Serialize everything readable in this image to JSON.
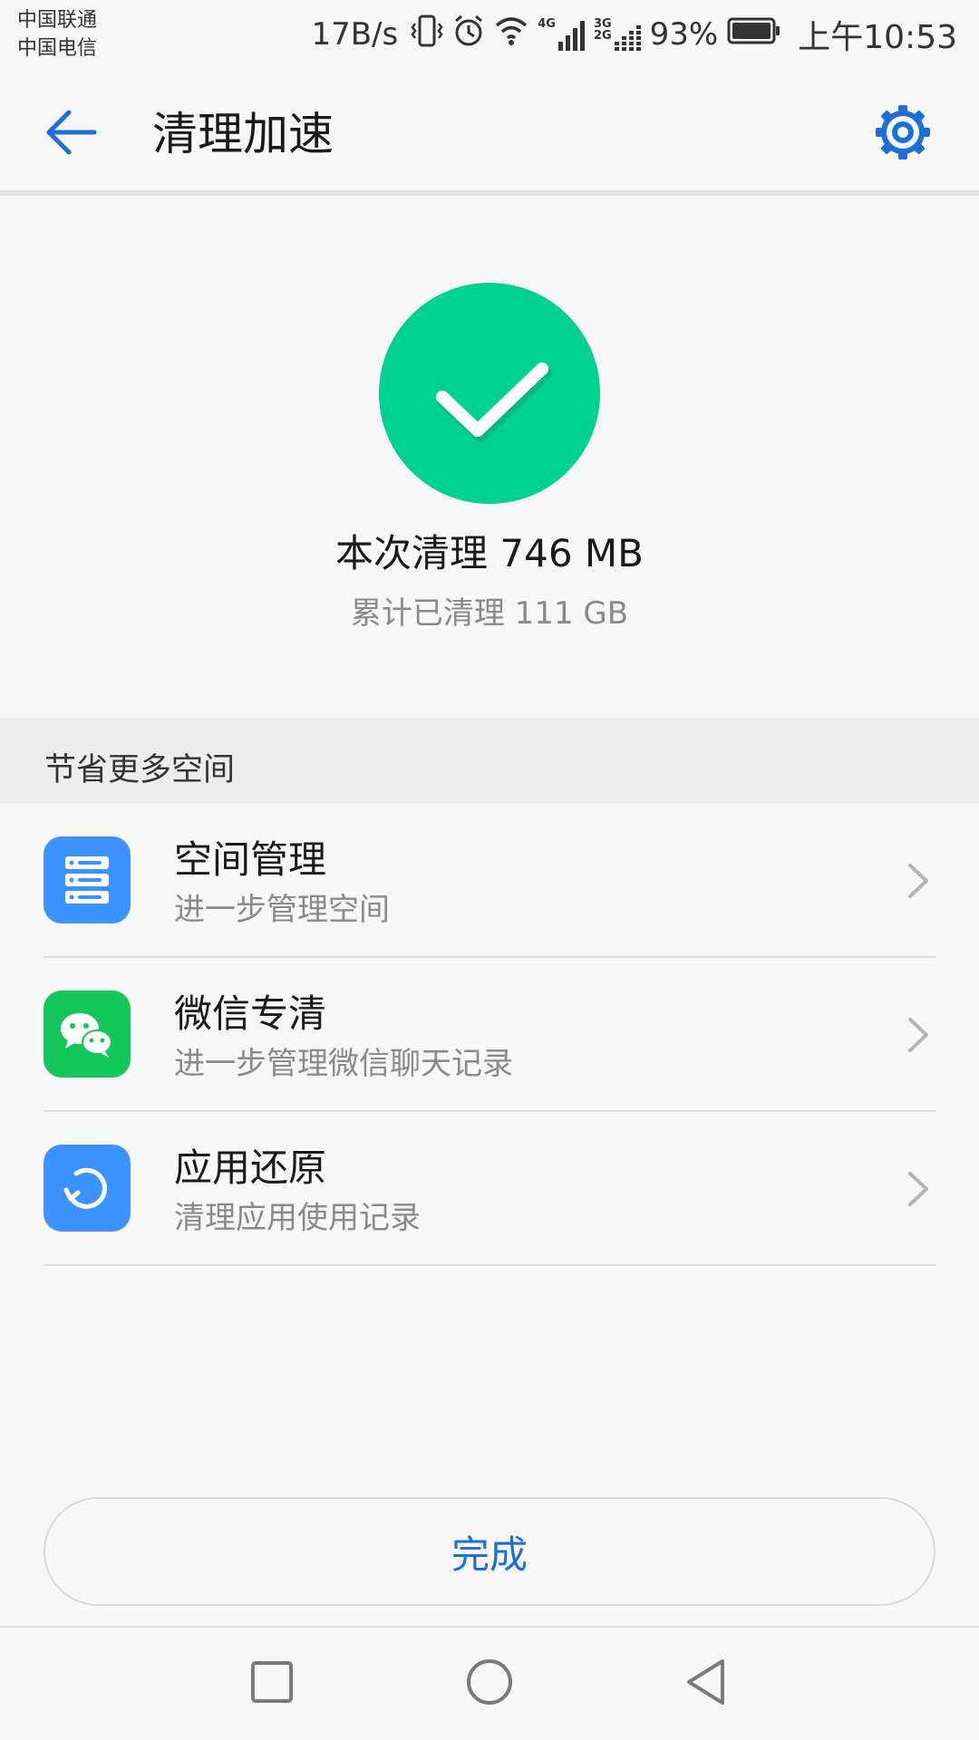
{
  "status_bar": {
    "carrier_1": "中国联通",
    "carrier_2": "中国电信",
    "net_speed": "17B/s",
    "sig1_label": "4G",
    "sig2_label_top": "3G",
    "sig2_label_bottom": "2G",
    "battery_pct": "93%",
    "time": "上午10:53",
    "icons": [
      "vibrate-icon",
      "alarm-icon",
      "wifi-icon",
      "signal-icon",
      "signal-icon",
      "battery-icon"
    ]
  },
  "app_bar": {
    "title": "清理加速",
    "back_icon": "back-arrow-icon",
    "settings_icon": "gear-icon"
  },
  "result": {
    "main_text": "本次清理 746 MB",
    "sub_text": "累计已清理 111 GB",
    "icon": "checkmark-icon",
    "icon_color": "#00d18f"
  },
  "section": {
    "title": "节省更多空间"
  },
  "items": [
    {
      "label": "空间管理",
      "desc": "进一步管理空间",
      "icon": "storage-icon",
      "color": "#3b93ff"
    },
    {
      "label": "微信专清",
      "desc": "进一步管理微信聊天记录",
      "icon": "wechat-icon",
      "color": "#15c75b"
    },
    {
      "label": "应用还原",
      "desc": "清理应用使用记录",
      "icon": "restore-icon",
      "color": "#3b93ff"
    }
  ],
  "done_button": {
    "label": "完成",
    "color": "#1b6fd6"
  },
  "nav_bar": {
    "icons": [
      "recent-apps-icon",
      "home-icon",
      "back-icon"
    ]
  },
  "colors": {
    "accent": "#1b6fd6",
    "success": "#00d18f",
    "background": "#f7f7f7"
  }
}
